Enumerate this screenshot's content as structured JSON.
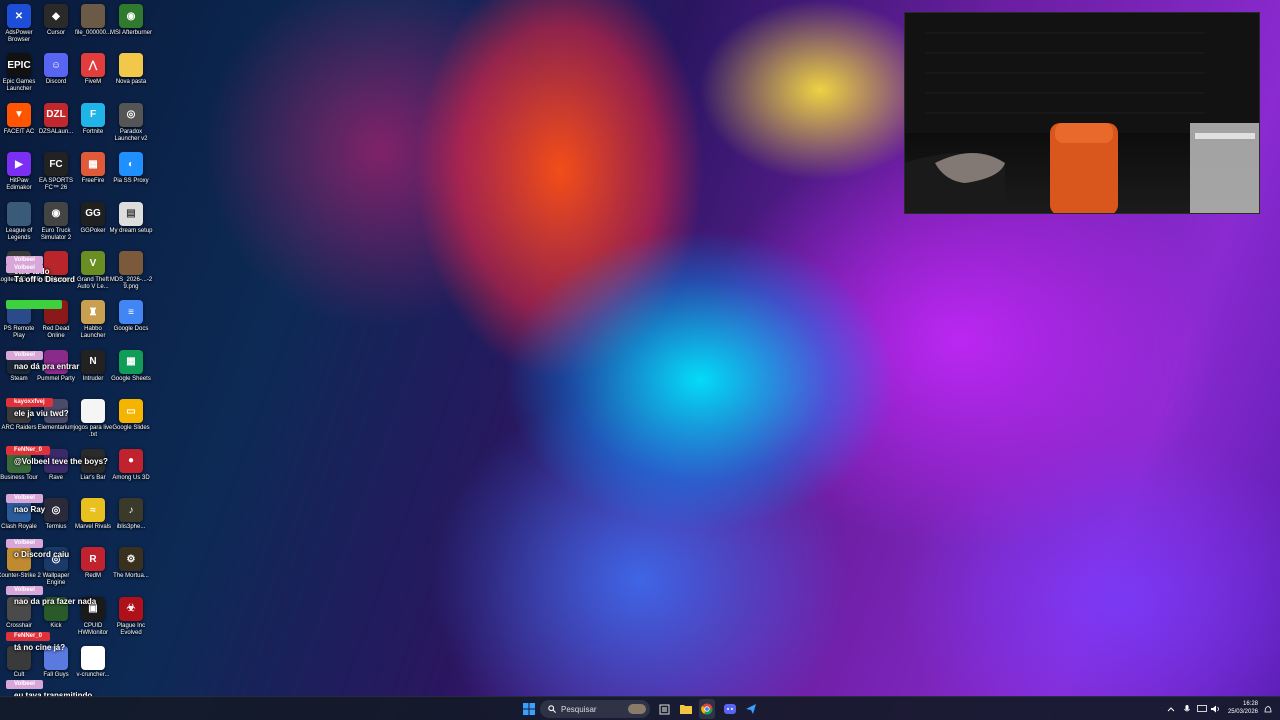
{
  "desktop": {
    "icons": [
      {
        "label": "AdsPower Browser",
        "glyph": "✕",
        "color": "#1d4ed8"
      },
      {
        "label": "Cursor",
        "glyph": "◆",
        "color": "#2a2a2a"
      },
      {
        "label": "file_000000...",
        "glyph": "",
        "color": "#6b5a45"
      },
      {
        "label": "MSI Afterburner",
        "glyph": "◉",
        "color": "#2f7a2f"
      },
      {
        "label": "Epic Games Launcher",
        "glyph": "EPIC",
        "color": "#111111"
      },
      {
        "label": "Discord",
        "glyph": "☺",
        "color": "#5865f2"
      },
      {
        "label": "FiveM",
        "glyph": "⋀",
        "color": "#e23d3d"
      },
      {
        "label": "Nova pasta",
        "glyph": "",
        "color": "#f2c84b"
      },
      {
        "label": "FACEIT AC",
        "glyph": "▼",
        "color": "#ff5500"
      },
      {
        "label": "DZSALaun...",
        "glyph": "DZL",
        "color": "#c0282d"
      },
      {
        "label": "Fortnite",
        "glyph": "F",
        "color": "#1fb5e8"
      },
      {
        "label": "Paradox Launcher v2",
        "glyph": "◎",
        "color": "#555555"
      },
      {
        "label": "HitPaw Edimakor",
        "glyph": "▶",
        "color": "#7b2ff2"
      },
      {
        "label": "EA SPORTS FC™ 26",
        "glyph": "FC",
        "color": "#222222"
      },
      {
        "label": "FreeFire",
        "glyph": "▦",
        "color": "#e05a3a"
      },
      {
        "label": "Pia SS Proxy",
        "glyph": "◐",
        "color": "#1e90ff"
      },
      {
        "label": "League of Legends",
        "glyph": "",
        "color": "#3a5a7a"
      },
      {
        "label": "Euro Truck Simulator 2",
        "glyph": "◉",
        "color": "#444444"
      },
      {
        "label": "GGPoker",
        "glyph": "GG",
        "color": "#202020"
      },
      {
        "label": "My dream setup",
        "glyph": "▤",
        "color": "#dddddd"
      },
      {
        "label": "Logitech G HUB",
        "glyph": "",
        "color": "#3a3a3a"
      },
      {
        "label": "Rockstar",
        "glyph": "",
        "color": "#b8262b"
      },
      {
        "label": "Grand Theft Auto V Le...",
        "glyph": "V",
        "color": "#6b8e23"
      },
      {
        "label": "MDS_2026-...-29.png",
        "glyph": "",
        "color": "#7a5a3a"
      },
      {
        "label": "PS Remote Play",
        "glyph": "",
        "color": "#2a4a8a"
      },
      {
        "label": "Red Dead Online",
        "glyph": "",
        "color": "#8a1a1a"
      },
      {
        "label": "Habbo Launcher",
        "glyph": "♜",
        "color": "#c8a050"
      },
      {
        "label": "Google Docs",
        "glyph": "≡",
        "color": "#4285f4"
      },
      {
        "label": "Steam",
        "glyph": "",
        "color": "#1b2838"
      },
      {
        "label": "Pummel Party",
        "glyph": "",
        "color": "#8a2a8a"
      },
      {
        "label": "Intruder",
        "glyph": "N",
        "color": "#222222"
      },
      {
        "label": "Google Sheets",
        "glyph": "▦",
        "color": "#0f9d58"
      },
      {
        "label": "ARC Raiders",
        "glyph": "",
        "color": "#3a3a3a"
      },
      {
        "label": "Elementarium",
        "glyph": "",
        "color": "#4a4a6a"
      },
      {
        "label": "jogos para live .txt",
        "glyph": "",
        "color": "#f5f5f5"
      },
      {
        "label": "Google Slides",
        "glyph": "▭",
        "color": "#f4b400"
      },
      {
        "label": "Business Tour",
        "glyph": "",
        "color": "#3a6a3a"
      },
      {
        "label": "Rave",
        "glyph": "",
        "color": "#3a2a6a"
      },
      {
        "label": "Liar's Bar",
        "glyph": "",
        "color": "#2a2a2a"
      },
      {
        "label": "Among Us 3D",
        "glyph": "●",
        "color": "#c0222e"
      },
      {
        "label": "Clash Royale",
        "glyph": "",
        "color": "#2a5a9a"
      },
      {
        "label": "Termius",
        "glyph": "◎",
        "color": "#2a2a3a"
      },
      {
        "label": "Marvel Rivals",
        "glyph": "≈",
        "color": "#e8c020"
      },
      {
        "label": "iblis3phe...",
        "glyph": "♪",
        "color": "#3a3a2a"
      },
      {
        "label": "Counter-Strike 2",
        "glyph": "",
        "color": "#c08a30"
      },
      {
        "label": "Wallpaper Engine",
        "glyph": "◎",
        "color": "#1a3a6a"
      },
      {
        "label": "RedM",
        "glyph": "R",
        "color": "#c0222e"
      },
      {
        "label": "The Mortua...",
        "glyph": "⚙",
        "color": "#3a3020"
      },
      {
        "label": "Crosshair",
        "glyph": "",
        "color": "#4a4a4a"
      },
      {
        "label": "Kick",
        "glyph": "",
        "color": "#2a5a2a"
      },
      {
        "label": "CPUID HWMonitor",
        "glyph": "▣",
        "color": "#1a1a1a"
      },
      {
        "label": "Plague Inc Evolved",
        "glyph": "☣",
        "color": "#b0101a"
      },
      {
        "label": "Cult",
        "glyph": "",
        "color": "#3a3a3a"
      },
      {
        "label": "Fall Guys",
        "glyph": "",
        "color": "#5a7adf"
      },
      {
        "label": "v-cruncher...",
        "glyph": "",
        "color": "#ffffff"
      }
    ]
  },
  "chat": {
    "messages": [
      {
        "user": "Volbeel",
        "color": "#d9a6d8",
        "text": "caiu tudo"
      },
      {
        "user": "Volbeel",
        "color": "#d9a6d8",
        "text": "Tá off o Discord"
      },
      {
        "user": "",
        "color": "#3dd23d",
        "text": ""
      },
      {
        "user": "Volbeel",
        "color": "#d9a6d8",
        "text": "nao dá pra entrar"
      },
      {
        "user": "kayoxxfvej",
        "color": "#e0303a",
        "text": "ele ja viu twd?"
      },
      {
        "user": "FeNNer_0",
        "color": "#e0303a",
        "text": "@Volbeel teve the boys?"
      },
      {
        "user": "Volbeel",
        "color": "#d9a6d8",
        "text": "nao Ray"
      },
      {
        "user": "Volbeel",
        "color": "#d9a6d8",
        "text": "o Discord caiu"
      },
      {
        "user": "Volbeel",
        "color": "#d9a6d8",
        "text": "nao da pra fazer nada"
      },
      {
        "user": "FeNNer_0",
        "color": "#e0303a",
        "text": "tá no cine já?"
      },
      {
        "user": "Volbeel",
        "color": "#d9a6d8",
        "text": "eu tava transmitindo"
      }
    ]
  },
  "taskbar": {
    "search_placeholder": "Pesquisar",
    "time": "16:28",
    "date": "25/03/2026"
  }
}
